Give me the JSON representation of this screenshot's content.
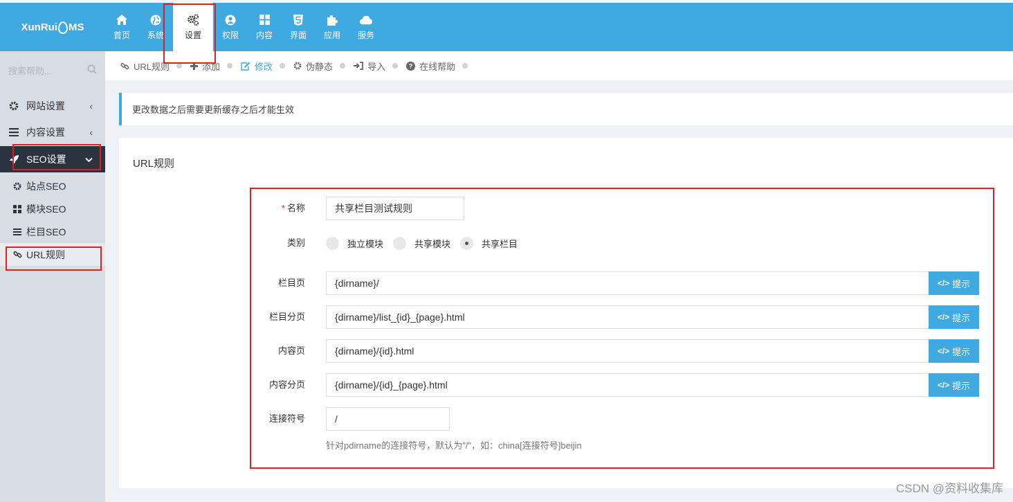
{
  "app": {
    "logo": [
      "XunRui",
      "MS"
    ]
  },
  "nav": [
    {
      "label": "首页",
      "icon": "home-icon"
    },
    {
      "label": "系统",
      "icon": "globe-icon"
    },
    {
      "label": "设置",
      "icon": "gears-icon"
    },
    {
      "label": "权限",
      "icon": "user-icon"
    },
    {
      "label": "内容",
      "icon": "grid-icon"
    },
    {
      "label": "界面",
      "icon": "html5-icon"
    },
    {
      "label": "应用",
      "icon": "puzzle-icon"
    },
    {
      "label": "服务",
      "icon": "cloud-icon"
    }
  ],
  "sidebar": {
    "search_placeholder": "搜索帮助...",
    "menus": [
      {
        "label": "网站设置",
        "icon": "gear-icon"
      },
      {
        "label": "内容设置",
        "icon": "bars-icon"
      },
      {
        "label": "SEO设置",
        "icon": "rocket-icon"
      }
    ],
    "sub": [
      {
        "label": "站点SEO",
        "icon": "gear-icon"
      },
      {
        "label": "模块SEO",
        "icon": "grid-icon"
      },
      {
        "label": "栏目SEO",
        "icon": "bars-icon"
      },
      {
        "label": "URL规则",
        "icon": "link-icon"
      }
    ]
  },
  "breadcrumbs": [
    {
      "label": "URL规则",
      "icon": "link-icon"
    },
    {
      "label": "添加",
      "icon": "plus-icon"
    },
    {
      "label": "修改",
      "icon": "edit-icon"
    },
    {
      "label": "伪静态",
      "icon": "gear-icon"
    },
    {
      "label": "导入",
      "icon": "sign-in-icon"
    },
    {
      "label": "在线帮助",
      "icon": "question-icon"
    }
  ],
  "notice": "更改数据之后需要更新缓存之后才能生效",
  "panel": {
    "title": "URL规则",
    "name_label": "名称",
    "name_value": "共享栏目测试规则",
    "type_label": "类别",
    "type_options": [
      "独立模块",
      "共享模块",
      "共享栏目"
    ],
    "type_selected": "共享栏目",
    "hint_label": "提示",
    "rows": [
      {
        "label": "栏目页",
        "value": "{dirname}/"
      },
      {
        "label": "栏目分页",
        "value": "{dirname}/list_{id}_{page}.html"
      },
      {
        "label": "内容页",
        "value": "{dirname}/{id}.html"
      },
      {
        "label": "内容分页",
        "value": "{dirname}/{id}_{page}.html"
      }
    ],
    "sep_label": "连接符号",
    "sep_value": "/",
    "sep_help": "针对pdirname的连接符号，默认为\"/\"，如：china[连接符号]beijin"
  },
  "watermark": "CSDN @资料收集库",
  "colors": {
    "accent": "#3fa9e0",
    "highlight_box": "#e02020",
    "sidebar_active": "#2b333e"
  }
}
